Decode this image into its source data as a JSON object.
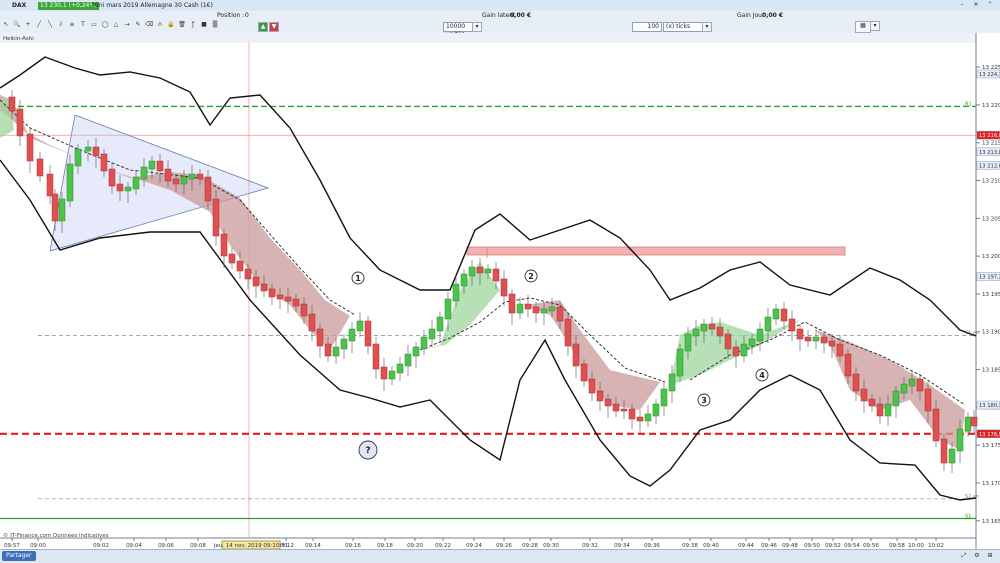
{
  "window": {
    "instrument": "DAX",
    "price_badge": "13 230,1 (+0,24%)",
    "title": "Mini mars 2019 Allemagne 30 Cash (1€)",
    "share_label": "Partager"
  },
  "toolbar": {
    "position_label": "Position :",
    "position_value": "0",
    "gain_latent_label": "Gain latent :",
    "gain_latent_value": "0,00 €",
    "gain_jour_label": "Gain Jour :",
    "gain_jour_value": "0,00 €",
    "units_value": "10000 unités",
    "ticks_value": "100",
    "ticks_unit": "(x) ticks",
    "indicator_label": "Heikin-Ashi",
    "timestamp_label": "jeu. 14 nov. 2019 09:10:31",
    "copyright": "© IT-Finance.com Données indicatives"
  },
  "colors": {
    "bull": "#4dc24d",
    "bear": "#e05050",
    "cloud_up": "#9fd59f",
    "cloud_down": "#c99a9a",
    "red_level": "#e02020",
    "green_level": "#2aa02a",
    "triangle": "#b9c4f0",
    "rect_zone": "#f3b0b0"
  },
  "chart_data": {
    "type": "candlestick",
    "y_axis": {
      "min": 13161,
      "max": 13227
    },
    "y_ticks": [
      "13 225",
      "13 220",
      "13 215",
      "13 210",
      "13 205",
      "13 200",
      "13 195",
      "13 190",
      "13 185",
      "13 180",
      "13 175",
      "13 170",
      "13 165"
    ],
    "x_ticks": [
      "09:57",
      "09:00",
      "09:02",
      "09:04",
      "09:06",
      "09:08",
      "09:12",
      "09:14",
      "09:16",
      "09:18",
      "09:20",
      "09:22",
      "09:24",
      "09:26",
      "09:28",
      "09:30",
      "09:32",
      "09:34",
      "09:36",
      "09:38",
      "09:40",
      "09:44",
      "09:46",
      "09:48",
      "09:50",
      "09:52",
      "09:54",
      "09:56",
      "09:58",
      "10:00",
      "10:02"
    ],
    "price_labels": [
      "13 224,1",
      "13 216,0",
      "13 213,8",
      "13 212,0",
      "13 197,3",
      "13 180,3",
      "13 176,5"
    ],
    "levels": [
      {
        "name": "R1",
        "value": 13219.8,
        "style": "dashed",
        "color": "#2aa02a",
        "tag": "R1"
      },
      {
        "name": "Pivot",
        "value": 13216.0,
        "style": "solid-thin",
        "color": "#e88080",
        "tag": ""
      },
      {
        "name": "R2red",
        "value": 13176.5,
        "style": "dashed-thick",
        "color": "#e02020",
        "tag": "Pv"
      },
      {
        "name": "S1",
        "value": 13165.3,
        "style": "solid",
        "color": "#2aa02a",
        "tag": "S1"
      },
      {
        "name": "mid1",
        "value": 13189.5,
        "style": "dashed-grey",
        "color": "#888888",
        "tag": "S1 en"
      },
      {
        "name": "mid2",
        "value": 13167.9,
        "style": "dashed-grey",
        "color": "#888888",
        "tag": "S2 en"
      }
    ],
    "annotations": [
      "1",
      "2",
      "3",
      "4",
      "?"
    ]
  }
}
